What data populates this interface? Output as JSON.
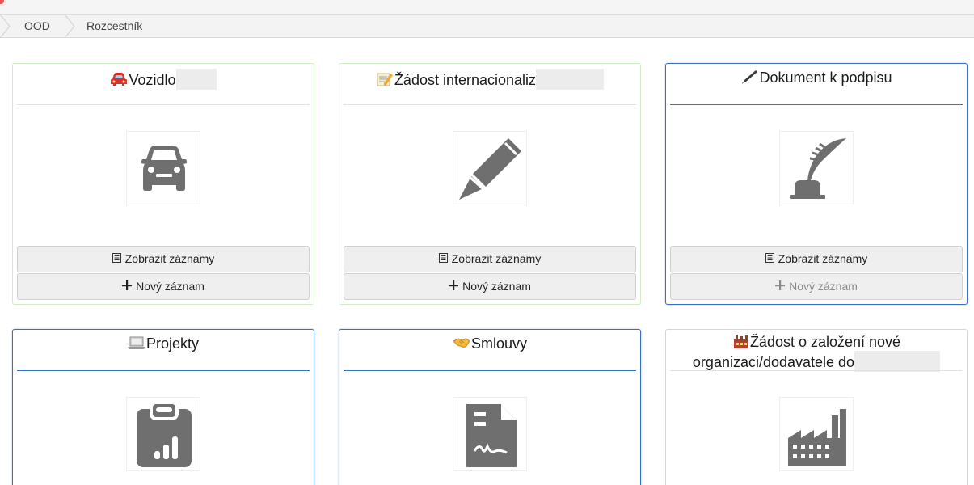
{
  "breadcrumb": {
    "items": [
      "OOD",
      "Rozcestník"
    ]
  },
  "cards": [
    {
      "title": "Vozidlo",
      "icon": "car-icon",
      "view_label": "Zobrazit záznamy",
      "new_label": "Nový záznam",
      "new_disabled": false
    },
    {
      "title": "Žádost internacionaliz",
      "icon": "pencil-icon",
      "view_label": "Zobrazit záznamy",
      "new_label": "Nový záznam",
      "new_disabled": false
    },
    {
      "title": "Dokument k podpisu",
      "icon": "quill-inkwell-icon",
      "view_label": "Zobrazit záznamy",
      "new_label": "Nový záznam",
      "new_disabled": true
    },
    {
      "title": "Projekty",
      "icon": "clipboard-chart-icon"
    },
    {
      "title": "Smlouvy",
      "icon": "signed-document-icon"
    },
    {
      "title_line1": "Žádost o založení nové",
      "title_line2": "organizaci/dodavatele do",
      "icon": "factory-icon"
    }
  ],
  "colors": {
    "active_border": "#3b6fc4",
    "green_border": "#d2ecc6",
    "icon_gray": "#6f6f6f"
  }
}
